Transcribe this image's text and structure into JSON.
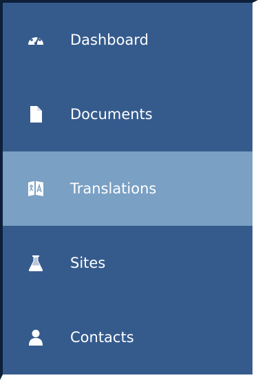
{
  "sidebar": {
    "active_color": "#7aa0c4",
    "background_color": "#355b8d",
    "items": [
      {
        "label": "Dashboard",
        "icon": "dashboard-icon",
        "active": false
      },
      {
        "label": "Documents",
        "icon": "document-icon",
        "active": false
      },
      {
        "label": "Translations",
        "icon": "translation-icon",
        "active": true
      },
      {
        "label": "Sites",
        "icon": "flask-icon",
        "active": false
      },
      {
        "label": "Contacts",
        "icon": "user-icon",
        "active": false
      }
    ]
  }
}
